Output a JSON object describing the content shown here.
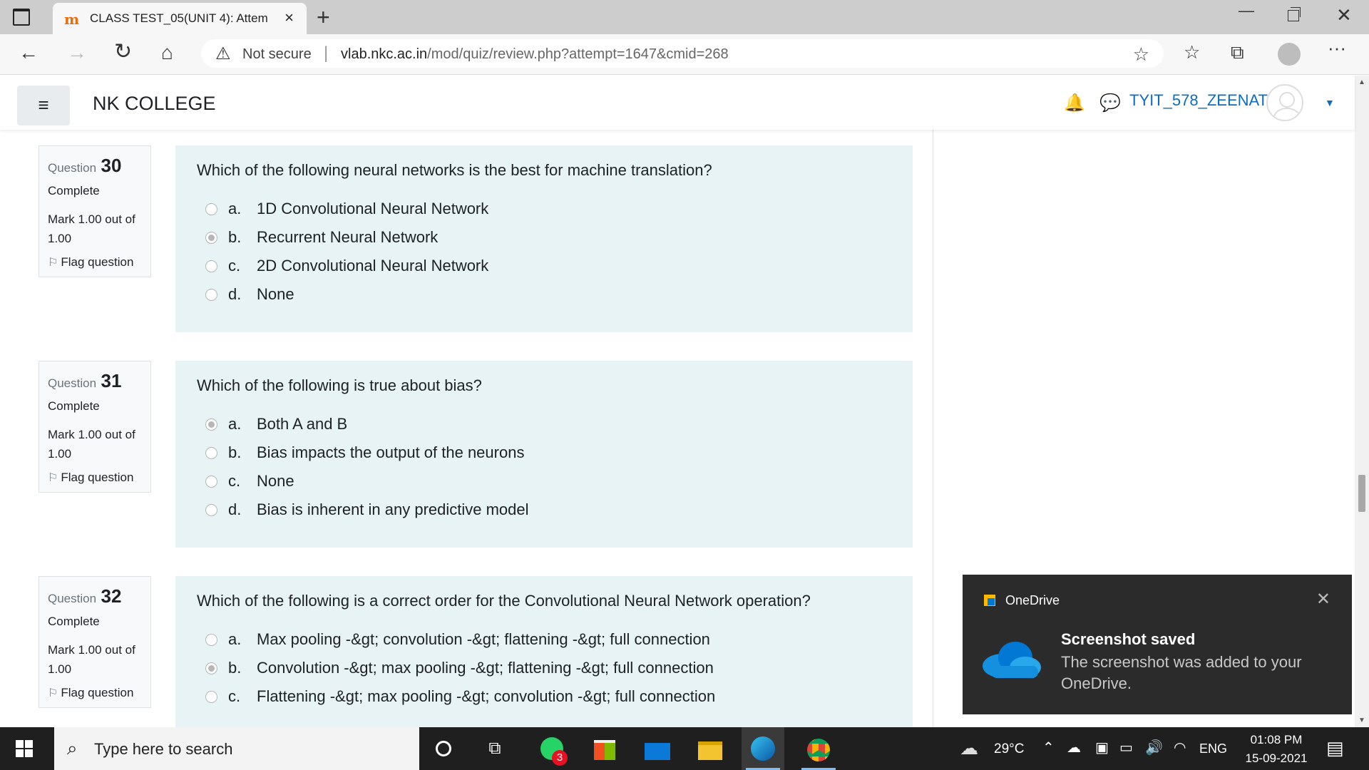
{
  "browser": {
    "tab_favicon": "m",
    "tab_title": "CLASS TEST_05(UNIT 4): Attempt",
    "tab_close": "×",
    "new_tab": "+",
    "window_controls": {
      "minimize": "—",
      "close": "✕"
    },
    "nav": {
      "back": "←",
      "forward": "→",
      "reload": "↻",
      "home": "⌂"
    },
    "security_icon": "⚠",
    "security_label": "Not secure",
    "separator": "|",
    "url_host": "vlab.nkc.ac.in",
    "url_path": "/mod/quiz/review.php?attempt=1647&cmid=268",
    "toolbar_icons": {
      "add_favorite": "☆",
      "favorites": "☆",
      "collections": "⧉",
      "more": "···"
    }
  },
  "header": {
    "menu_glyph": "≡",
    "site_name": "NK COLLEGE",
    "bell": "🔔",
    "chat": "💬",
    "username": "TYIT_578_ZEENAT .",
    "caret": "▼"
  },
  "questions": [
    {
      "label": "Question",
      "number": "30",
      "state": "Complete",
      "grade": "Mark 1.00 out of 1.00",
      "flag": "Flag question",
      "text": "Which of the following neural networks is the best for machine translation?",
      "answers": [
        {
          "letter": "a.",
          "text": "1D Convolutional Neural Network",
          "checked": false
        },
        {
          "letter": "b.",
          "text": "Recurrent Neural Network",
          "checked": true
        },
        {
          "letter": "c.",
          "text": "2D Convolutional Neural Network",
          "checked": false
        },
        {
          "letter": "d.",
          "text": "None",
          "checked": false
        }
      ]
    },
    {
      "label": "Question",
      "number": "31",
      "state": "Complete",
      "grade": "Mark 1.00 out of 1.00",
      "flag": "Flag question",
      "text": "Which of the following is true about bias?",
      "answers": [
        {
          "letter": "a.",
          "text": "Both A and B",
          "checked": true
        },
        {
          "letter": "b.",
          "text": "Bias impacts the output of the neurons",
          "checked": false
        },
        {
          "letter": "c.",
          "text": "None",
          "checked": false
        },
        {
          "letter": "d.",
          "text": "Bias is inherent in any predictive model",
          "checked": false
        }
      ]
    },
    {
      "label": "Question",
      "number": "32",
      "state": "Complete",
      "grade": "Mark 1.00 out of 1.00",
      "flag": "Flag question",
      "text": "Which of the following is a correct order for the Convolutional Neural Network operation?",
      "answers": [
        {
          "letter": "a.",
          "text": "Max pooling -&gt; convolution -&gt; flattening -&gt; full connection",
          "checked": false
        },
        {
          "letter": "b.",
          "text": "Convolution -&gt; max pooling -&gt; flattening -&gt; full connection",
          "checked": true
        },
        {
          "letter": "c.",
          "text": "Flattening -&gt; max pooling -&gt; convolution -&gt; full connection",
          "checked": false
        }
      ]
    }
  ],
  "toast": {
    "app": "OneDrive",
    "close": "✕",
    "title": "Screenshot saved",
    "body": "The screenshot was added to your OneDrive."
  },
  "taskbar": {
    "search_placeholder": "Type here to search",
    "whatsapp_badge": "3",
    "temperature": "29°C",
    "language": "ENG",
    "time": "01:08 PM",
    "date": "15-09-2021"
  },
  "colors": {
    "accent": "#0f6cbf",
    "question_bg": "#e7f3f5",
    "taskbar": "#1f1f1f",
    "toast": "#2b2b2b"
  }
}
